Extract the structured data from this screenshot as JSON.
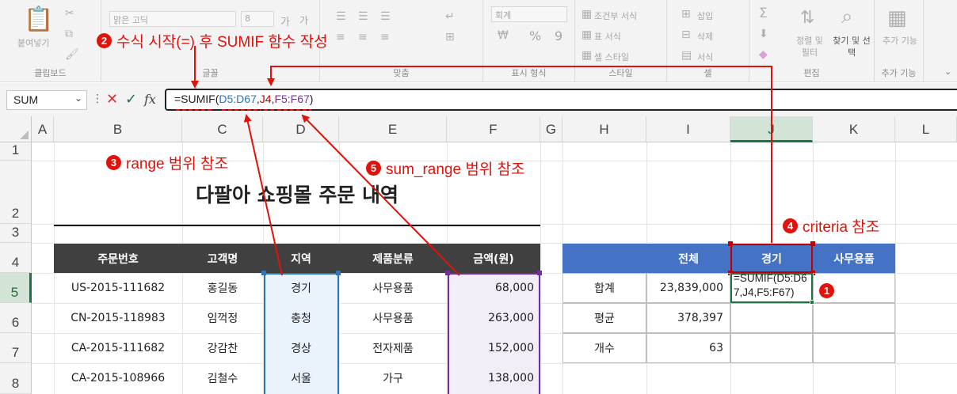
{
  "ribbon": {
    "groups": [
      {
        "label": "클립보드",
        "items": [
          "붙여넣기"
        ]
      },
      {
        "label": "글꼴",
        "items": [
          "맑은 고딕",
          "8",
          "가",
          "가"
        ]
      },
      {
        "label": "맞춤",
        "items": []
      },
      {
        "label": "표시 형식",
        "items": [
          "회계",
          "%",
          "9"
        ]
      },
      {
        "label": "스타일",
        "items": [
          "조건부 서식",
          "표 서식",
          "셀 스타일"
        ]
      },
      {
        "label": "셀",
        "items": [
          "삽입",
          "삭제",
          "서식"
        ]
      },
      {
        "label": "편집",
        "items": [
          "정렬 및 필터",
          "찾기 및 선택"
        ]
      },
      {
        "label": "추가 기능",
        "items": [
          "추가 기능"
        ]
      }
    ]
  },
  "formula_bar": {
    "name_box": "SUM",
    "fx": "fx",
    "formula": {
      "prefix": "=SUMIF(",
      "range": "D5:D67",
      "sep1": ",",
      "criteria": "J4",
      "sep2": ",",
      "sum_range": "F5:F67",
      "suffix": ")"
    }
  },
  "sheet": {
    "columns": [
      "A",
      "B",
      "C",
      "D",
      "E",
      "F",
      "G",
      "H",
      "I",
      "J",
      "K",
      "L"
    ],
    "rows": [
      "1",
      "2",
      "3",
      "4",
      "5",
      "6",
      "7",
      "8"
    ],
    "title": "다팔아 쇼핑몰 주문 내역",
    "table": {
      "headers": [
        "주문번호",
        "고객명",
        "지역",
        "제품분류",
        "금액(원)"
      ],
      "rows": [
        [
          "US-2015-111682",
          "홍길동",
          "경기",
          "사무용품",
          "68,000"
        ],
        [
          "CN-2015-118983",
          "임꺽정",
          "충청",
          "사무용품",
          "263,000"
        ],
        [
          "CA-2015-111682",
          "강감찬",
          "경상",
          "전자제품",
          "152,000"
        ],
        [
          "CA-2015-108966",
          "김철수",
          "서울",
          "가구",
          "138,000"
        ]
      ]
    },
    "summary": {
      "headers": [
        "",
        "전체",
        "경기",
        "사무용품"
      ],
      "rows": [
        [
          "합계",
          "23,839,000",
          "=SUMIF(D5:D67,J4,F5:F67)",
          ""
        ],
        [
          "평균",
          "378,397",
          "",
          ""
        ],
        [
          "개수",
          "63",
          "",
          ""
        ]
      ]
    }
  },
  "annotations": {
    "a1": {
      "badge": "1",
      "text": ""
    },
    "a2": {
      "badge": "2",
      "text": "수식 시작(=) 후 SUMIF 함수 작성"
    },
    "a3": {
      "badge": "3",
      "text": "range 범위 참조"
    },
    "a4": {
      "badge": "4",
      "text": "criteria 참조"
    },
    "a5": {
      "badge": "5",
      "text": "sum_range 범위 참조"
    }
  },
  "colors": {
    "annotation_red": "#e0120b",
    "table_header_dark": "#404040",
    "summary_header_blue": "#4472c4",
    "range_blue": "#2e75b6",
    "range_fill": "#eaf3fb",
    "criteria_red": "#c00000",
    "sum_range_purple": "#7030a0",
    "sum_range_fill": "#f3edf7",
    "active_green": "#1e7145"
  }
}
